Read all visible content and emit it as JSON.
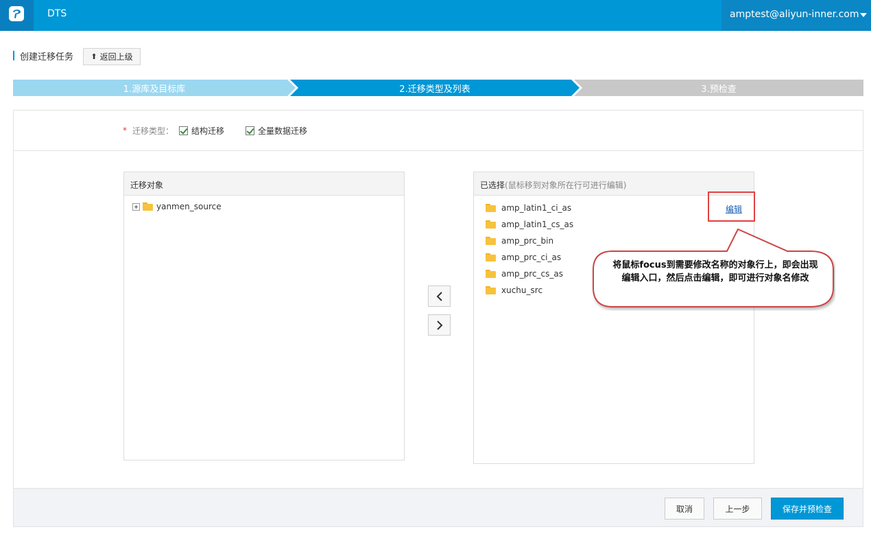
{
  "header": {
    "app_name": "DTS",
    "user_email": "amptest@aliyun-inner.com"
  },
  "page": {
    "title": "创建迁移任务",
    "back_label": "返回上级"
  },
  "steps": [
    {
      "label": "1.源库及目标库",
      "state": "done"
    },
    {
      "label": "2.迁移类型及列表",
      "state": "active"
    },
    {
      "label": "3.预检查",
      "state": "pending"
    }
  ],
  "migration_type": {
    "required_mark": "*",
    "label": "迁移类型：",
    "options": [
      {
        "label": "结构迁移",
        "checked": true
      },
      {
        "label": "全量数据迁移",
        "checked": true
      }
    ]
  },
  "source_list": {
    "header": "迁移对象",
    "items": [
      {
        "label": "yanmen_source"
      }
    ]
  },
  "selected_list": {
    "header": "已选择",
    "hint": "(鼠标移到对象所在行可进行编辑)",
    "edit_label": "编辑",
    "items": [
      {
        "label": "amp_latin1_ci_as"
      },
      {
        "label": "amp_latin1_cs_as"
      },
      {
        "label": "amp_prc_bin"
      },
      {
        "label": "amp_prc_ci_as"
      },
      {
        "label": "amp_prc_cs_as"
      },
      {
        "label": "xuchu_src"
      }
    ]
  },
  "callout": {
    "text": "将鼠标focus到需要修改名称的对象行上，即会出现编辑入口，然后点击编辑，即可进行对象名修改"
  },
  "footer": {
    "cancel_label": "取消",
    "prev_label": "上一步",
    "save_label": "保存并预检查"
  },
  "colors": {
    "brand": "#0097d6",
    "step_done": "#9cd7f0",
    "step_pending": "#c8c8c8",
    "highlight": "#e04040"
  }
}
